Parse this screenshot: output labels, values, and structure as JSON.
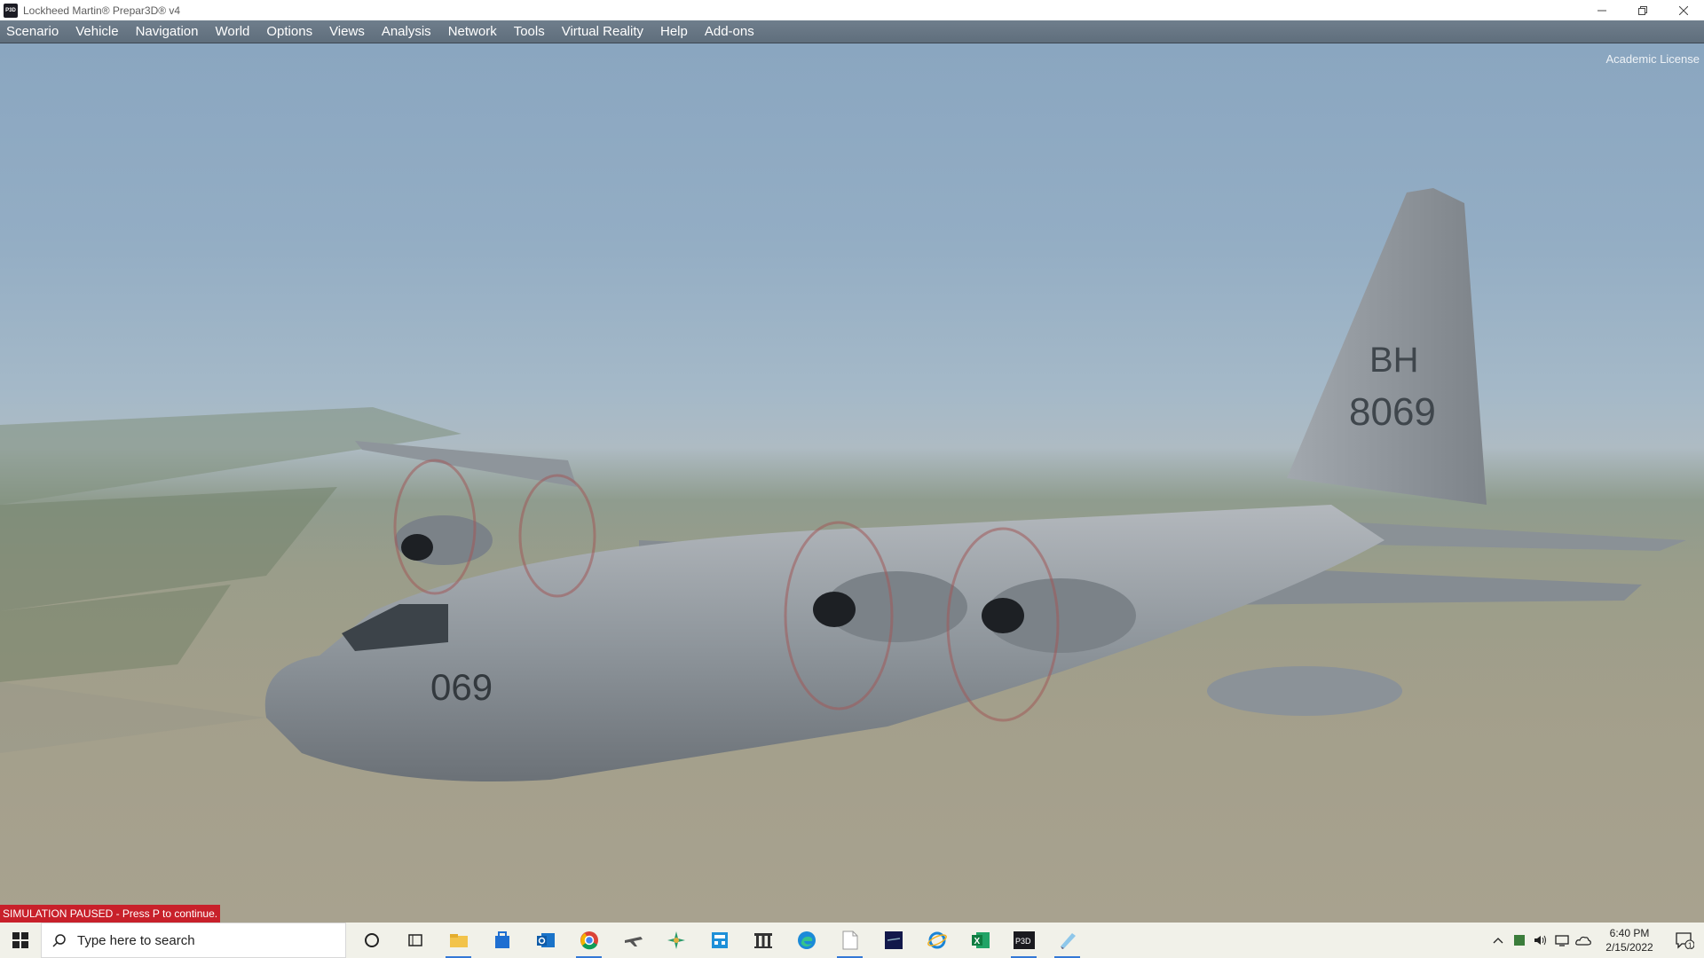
{
  "window": {
    "title": "Lockheed Martin® Prepar3D® v4",
    "logo_text": "P3D"
  },
  "menu": {
    "items": [
      {
        "label": "Scenario"
      },
      {
        "label": "Vehicle"
      },
      {
        "label": "Navigation"
      },
      {
        "label": "World"
      },
      {
        "label": "Options"
      },
      {
        "label": "Views"
      },
      {
        "label": "Analysis"
      },
      {
        "label": "Network"
      },
      {
        "label": "Tools"
      },
      {
        "label": "Virtual Reality"
      },
      {
        "label": "Help"
      },
      {
        "label": "Add-ons"
      }
    ]
  },
  "viewport": {
    "license": "Academic License",
    "status": "SIMULATION PAUSED - Press P to continue.",
    "aircraft": {
      "tail_code": "BH",
      "tail_number": "8069",
      "nose_number": "069"
    }
  },
  "taskbar": {
    "search_placeholder": "Type here to search",
    "apps": [
      {
        "icon": "cortana-icon"
      },
      {
        "icon": "task-view-icon"
      },
      {
        "icon": "file-explorer-icon"
      },
      {
        "icon": "microsoft-store-icon"
      },
      {
        "icon": "outlook-icon"
      },
      {
        "icon": "chrome-icon"
      },
      {
        "icon": "flight-app-icon"
      },
      {
        "icon": "aircraft-tool-icon"
      },
      {
        "icon": "calculator-app-icon"
      },
      {
        "icon": "building-app-icon"
      },
      {
        "icon": "edge-icon"
      },
      {
        "icon": "notepad-icon"
      },
      {
        "icon": "dark-app-icon"
      },
      {
        "icon": "internet-explorer-icon"
      },
      {
        "icon": "excel-icon"
      },
      {
        "icon": "p3d-icon"
      },
      {
        "icon": "wing-app-icon"
      }
    ],
    "p3d_label": "P3D",
    "excel_label": "X",
    "time": "6:40 PM",
    "date": "2/15/2022",
    "notification_count": "1"
  }
}
